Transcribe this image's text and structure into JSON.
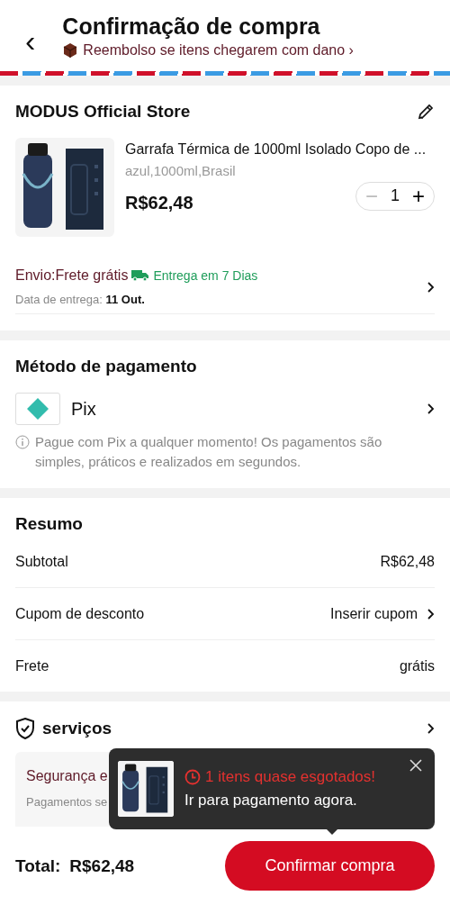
{
  "header": {
    "back": "‹",
    "title": "Confirmação de compra",
    "refund_notice": "Reembolso se itens chegarem com dano ›"
  },
  "store": {
    "name": "MODUS Official Store",
    "product": {
      "kind": "picture",
      "title": "Garrafa Térmica de 1000ml Isolado Copo de ...",
      "variant": "azul,1000ml,Brasil",
      "price": "R$62,48",
      "quantity": "1",
      "minus": "−",
      "plus": "+",
      "minus_disabled": true
    },
    "shipping": {
      "label": "Envio:Frete grátis",
      "delivery_speed": "Entrega em 7 Dias",
      "date_label": "Data de entrega: **11 Out.**"
    }
  },
  "payment": {
    "heading": "Método de pagamento",
    "method": "Pix",
    "note": "Pague com Pix a qualquer momento! Os pagamentos são simples, práticos e realizados em segundos."
  },
  "summary": {
    "heading": "Resumo",
    "rows": [
      {
        "label": "Subtotal",
        "value": "R$62,48",
        "kind": "plain"
      },
      {
        "label": "Cupom de desconto",
        "value": "Inserir cupom",
        "kind": "link"
      },
      {
        "label": "Frete",
        "value": "grátis",
        "kind": "plain"
      }
    ]
  },
  "services": {
    "heading": "serviços",
    "items": [
      {
        "title": "Segurança e",
        "subtitle": "Pagamentos se"
      }
    ]
  },
  "popup": {
    "kind": "picture",
    "alert": "1 itens quase esgotados!",
    "message": "Ir para pagamento agora."
  },
  "footer": {
    "total_label": "Total:",
    "total": "R$62,48",
    "confirm": "Confirmar compra"
  }
}
